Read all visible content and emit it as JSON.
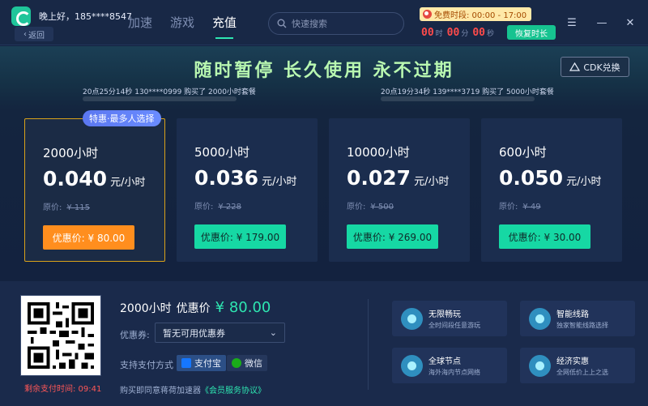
{
  "header": {
    "greeting": "晚上好，185****8547",
    "back_label": "返回",
    "nav": [
      "加速",
      "游戏",
      "充值"
    ],
    "active_nav": "充值",
    "search_placeholder": "快速搜索",
    "free_period": "免费时段: 00:00 - 17:00",
    "timer": {
      "hours": "00",
      "hours_unit": "时",
      "minutes": "00",
      "minutes_unit": "分",
      "seconds": "00",
      "seconds_unit": "秒"
    },
    "resume_label": "恢复时长"
  },
  "banner": {
    "title": "随时暂停 长久使用 永不过期",
    "cdk_label": "CDK兑换",
    "ticker_left": "20点25分14秒 130****0999 购买了 2000小时套餐",
    "ticker_right": "20点19分34秒 139****3719 购买了 5000小时套餐"
  },
  "hot_tag": "特惠·最多人选择",
  "plans": [
    {
      "name": "2000小时",
      "price": "0.040",
      "unit": "元/小时",
      "orig_label": "原价:",
      "orig_price": "¥ 115",
      "button": "优惠价: ¥ 80.00",
      "selected": true
    },
    {
      "name": "5000小时",
      "price": "0.036",
      "unit": "元/小时",
      "orig_label": "原价:",
      "orig_price": "¥ 228",
      "button": "优惠价: ¥ 179.00",
      "selected": false
    },
    {
      "name": "10000小时",
      "price": "0.027",
      "unit": "元/小时",
      "orig_label": "原价:",
      "orig_price": "¥ 500",
      "button": "优惠价: ¥ 269.00",
      "selected": false
    },
    {
      "name": "600小时",
      "price": "0.050",
      "unit": "元/小时",
      "orig_label": "原价:",
      "orig_price": "¥ 49",
      "button": "优惠价: ¥ 30.00",
      "selected": false
    }
  ],
  "checkout": {
    "countdown": "剩余支付时间: 09:41",
    "plan": "2000小时",
    "price_label": "优惠价",
    "price": "¥ 80.00",
    "coupon_label": "优惠券:",
    "coupon_value": "暂无可用优惠券",
    "pay_label": "支持支付方式",
    "pay_methods": [
      "支付宝",
      "微信"
    ],
    "agree_text": "购买即同意蒋荷加速器",
    "agree_link": "《会员服务协议》"
  },
  "features": [
    {
      "title": "无限畅玩",
      "desc": "全时间段任意游玩"
    },
    {
      "title": "智能线路",
      "desc": "独家智能线路选择"
    },
    {
      "title": "全球节点",
      "desc": "海外海内节点网络"
    },
    {
      "title": "经济实惠",
      "desc": "全网低价上上之选"
    }
  ],
  "colors": {
    "accent": "#2ee6b1",
    "orange": "#ff8e1e",
    "countdown": "#ff5757"
  }
}
